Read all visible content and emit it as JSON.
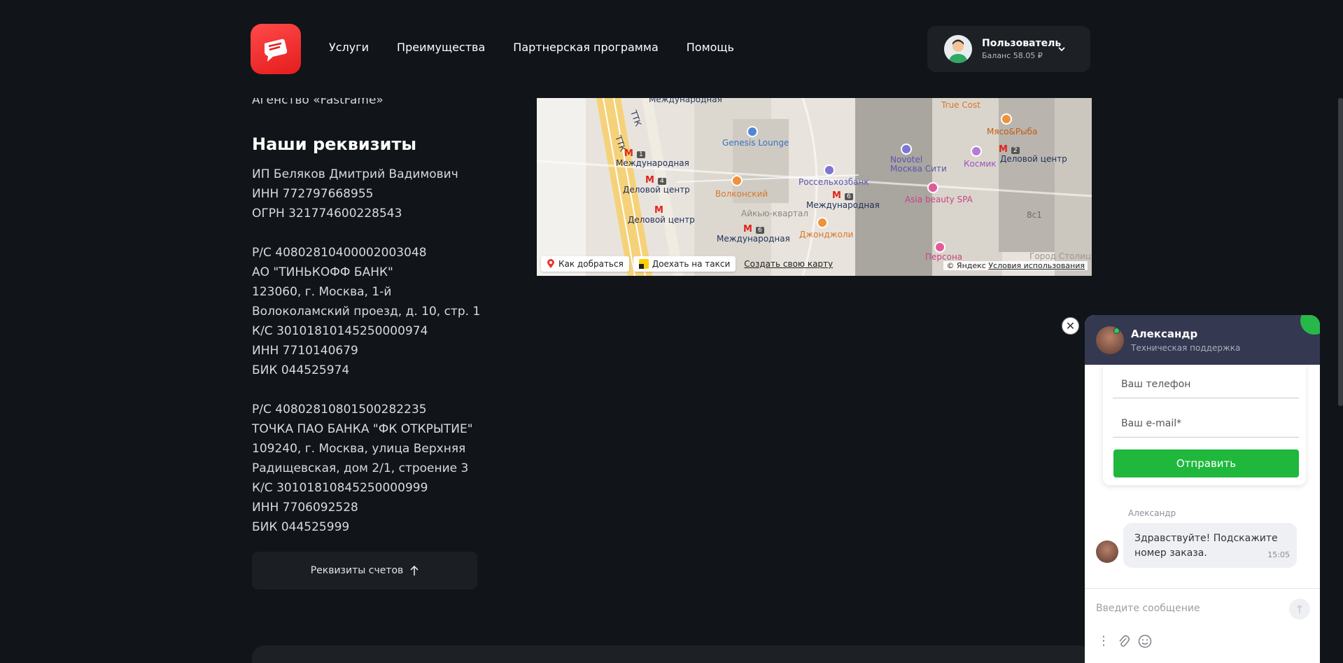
{
  "header": {
    "nav": [
      "Услуги",
      "Преимущества",
      "Партнерская программа",
      "Помощь"
    ],
    "user": {
      "name": "Пользователь",
      "balance": "Баланс 58.05 ₽"
    }
  },
  "content": {
    "agency": "Агенство «FastFame»",
    "section_title": "Наши реквизиты",
    "requisites": [
      "ИП Беляков Дмитрий Вадимович",
      "ИНН 772797668955",
      "ОГРН 321774600228543",
      "",
      "Р/С 40802810400002003048",
      "АО \"ТИНЬКОФФ БАНК\"",
      "123060, г. Москва, 1-й",
      "Волоколамский проезд, д. 10, стр. 1",
      "К/С 30101810145250000974",
      "ИНН 7710140679",
      "БИК 044525974",
      "",
      "Р/С 40802810801500282235",
      "ТОЧКА ПАО БАНКА \"ФК ОТКРЫТИЕ\"",
      "109240, г. Москва, улица Верхняя",
      "Радищевская, дом 2/1, строение 3",
      "К/С 30101810845250000999",
      "ИНН 7706092528",
      "БИК 044525999"
    ],
    "requisites_button": "Реквизиты счетов"
  },
  "map": {
    "labels": {
      "ttk1": "ТТК",
      "ttk2": "ТТК",
      "mezhd_top": "Международная",
      "metro1": "Международная",
      "metro2": "Деловой центр",
      "metro3": "Деловой центр",
      "metro4": "Международная",
      "metro5": "Международная",
      "metro6": "Деловой центр",
      "genesis": "Genesis Lounge",
      "volkonsky": "Волконский",
      "rossel": "Россельхозбанк",
      "aiko": "Айкью-квартал",
      "novotel": "Novotel\nМосква Сити",
      "truecost": "True Cost",
      "myaso": "Мясо&Рыба",
      "kosmik": "Космик",
      "asia": "Asia beauty SPA",
      "dzhon": "Джонджоли",
      "persona": "Персона",
      "gorod": "Город Столиц",
      "h8c1": "8с1"
    },
    "line_badges": {
      "l1": "1",
      "l4": "4",
      "l6a": "6",
      "l6b": "6",
      "l2": "2"
    },
    "route_button": "Как добраться",
    "taxi_button": "Доехать на такси",
    "create_map": "Создать свою карту",
    "copyright": "© Яндекс",
    "terms": "Условия использования"
  },
  "chat": {
    "agent_name": "Александр",
    "agent_role": "Техническая поддержка",
    "phone_placeholder": "Ваш телефон",
    "email_placeholder": "Ваш e-mail*",
    "send_label": "Отправить",
    "message_author": "Александр",
    "message_text": "Здравствуйте! Подскажите номер заказа.",
    "message_time": "15:05",
    "input_placeholder": "Введите сообщение"
  },
  "colors": {
    "background": "#111418",
    "accent_red": "#e51c1c",
    "chat_header": "#343850",
    "send_green": "#1fb83d"
  }
}
